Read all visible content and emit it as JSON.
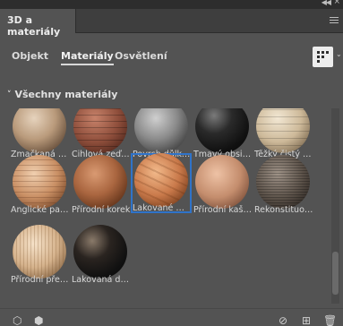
{
  "panel": {
    "title": "3D a materiály"
  },
  "subtabs": [
    {
      "label": "Objekt"
    },
    {
      "label": "Materiály"
    },
    {
      "label": "Osvětlení"
    }
  ],
  "section": {
    "title": "Všechny materiály"
  },
  "materials": [
    {
      "label": "Zmačkaná pla...",
      "icon": "crumpled-material-sphere"
    },
    {
      "label": "Cihlová zeď C...",
      "icon": "brick-wall-sphere"
    },
    {
      "label": "Povrch důlku ...",
      "icon": "dimpled-surface-sphere"
    },
    {
      "label": "Tmavý obsidián",
      "icon": "dark-obsidian-sphere"
    },
    {
      "label": "Těžký čistý zl...",
      "icon": "heavy-stone-sphere"
    },
    {
      "label": "Anglické park...",
      "icon": "parquet-sphere"
    },
    {
      "label": "Přírodní korek",
      "icon": "cork-sphere"
    },
    {
      "label": "Lakované mo...",
      "icon": "lacquered-wood-sphere"
    },
    {
      "label": "Přírodní kašta...",
      "icon": "chestnut-wood-sphere"
    },
    {
      "label": "Rekonstituov...",
      "icon": "reconstituted-wood-sphere"
    },
    {
      "label": "Přírodní překli...",
      "icon": "plywood-sphere"
    },
    {
      "label": "Lakovaná dře...",
      "icon": "lacquered-dark-wood-sphere"
    }
  ],
  "selected_material": "Lakované mo...",
  "colors": {
    "panel_bg": "#535353",
    "selection": "#2f73c9"
  }
}
